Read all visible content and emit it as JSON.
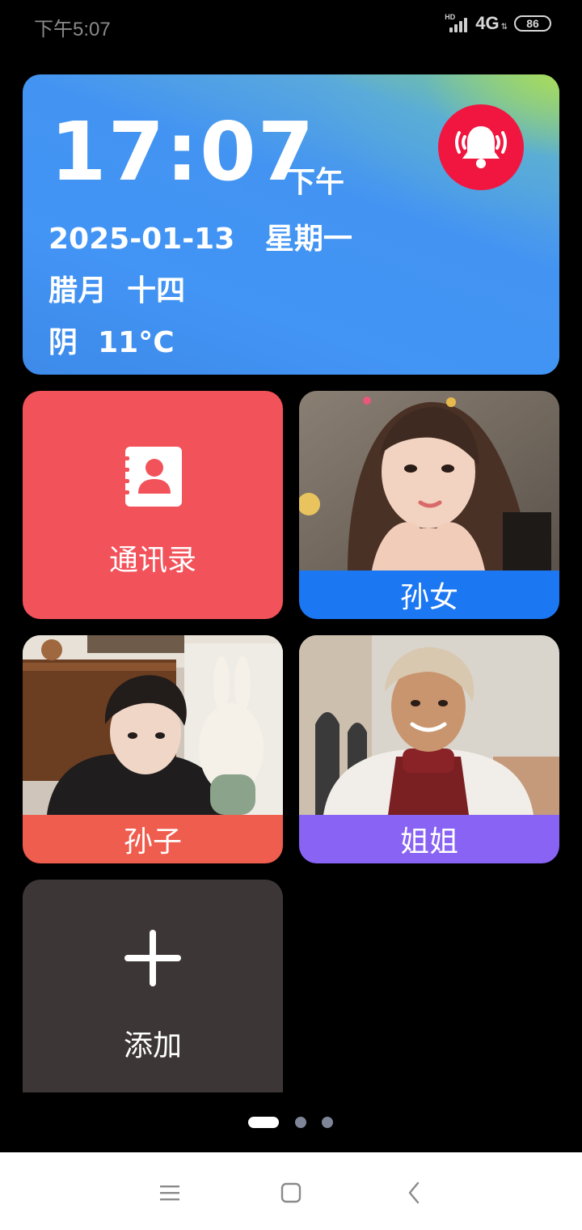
{
  "status_bar": {
    "time": "下午5:07",
    "network": "4G",
    "signal_badge": "HD",
    "battery": "86"
  },
  "clock": {
    "time": "17:07",
    "ampm": "下午",
    "date": "2025-01-13",
    "weekday": "星期一",
    "lunar_month": "腊月",
    "lunar_day": "十四",
    "weather": "阴",
    "temperature": "11°C",
    "alarm_icon": "alarm-bell-icon"
  },
  "tiles": {
    "contacts": {
      "label": "通讯录",
      "icon": "contacts-book-icon"
    },
    "granddaughter": {
      "label": "孙女"
    },
    "grandson": {
      "label": "孙子"
    },
    "sister": {
      "label": "姐姐"
    },
    "add": {
      "label": "添加",
      "icon": "plus-icon"
    }
  },
  "pager": {
    "pages": 3,
    "current": 1
  },
  "nav_bar": {
    "menu_icon": "menu-icon",
    "home_icon": "home-square-icon",
    "back_icon": "back-chevron-icon"
  },
  "colors": {
    "contacts_tile": "#f2525a",
    "granddaughter_bar": "#1c77f2",
    "grandson_bar": "#ef5d4e",
    "sister_bar": "#8963f3",
    "add_tile": "#3d3636",
    "alarm": "#f1163f",
    "clock_card": "#4294f5"
  }
}
